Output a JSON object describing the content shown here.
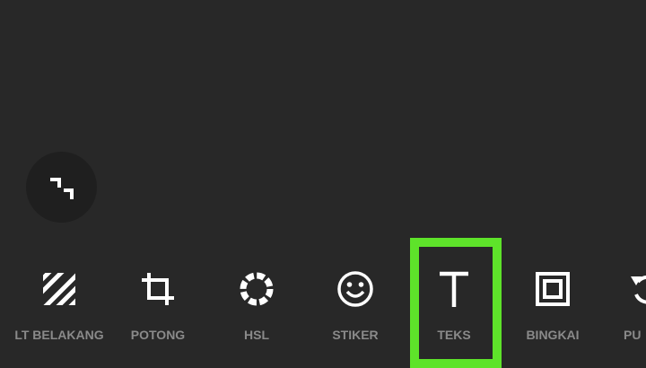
{
  "toolbar": {
    "items": [
      {
        "label": "LT BELAKANG",
        "icon": "background-icon"
      },
      {
        "label": "POTONG",
        "icon": "crop-icon"
      },
      {
        "label": "HSL",
        "icon": "hsl-icon"
      },
      {
        "label": "STIKER",
        "icon": "smiley-icon"
      },
      {
        "label": "TEKS",
        "icon": "text-icon"
      },
      {
        "label": "BINGKAI",
        "icon": "frame-icon"
      },
      {
        "label": "PU",
        "icon": "rotate-icon"
      }
    ]
  },
  "colors": {
    "background": "#282828",
    "highlight": "#5ee32a",
    "label": "#8a8a8a",
    "icon": "#ffffff"
  },
  "collapse_button": {
    "icon": "collapse-icon"
  }
}
